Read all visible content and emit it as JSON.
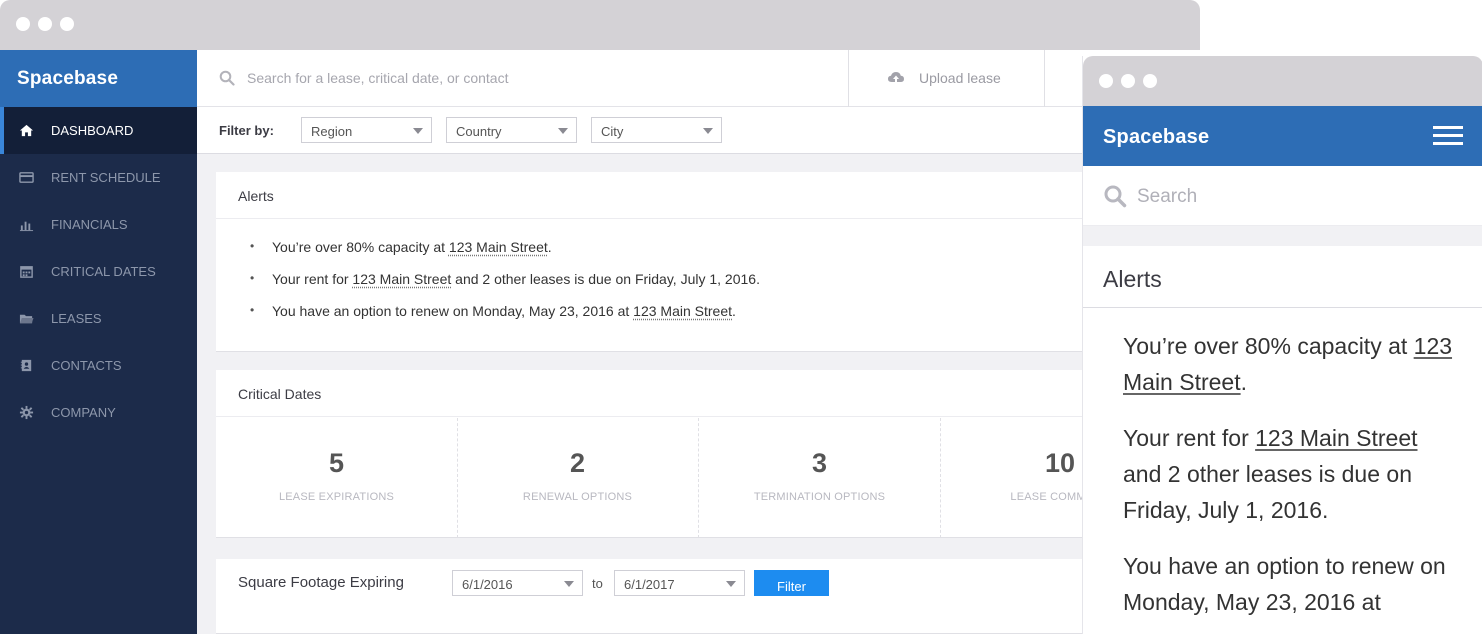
{
  "desktop": {
    "brand": "Spacebase",
    "nav": [
      {
        "label": "DASHBOARD",
        "icon": "home-icon",
        "active": true
      },
      {
        "label": "RENT SCHEDULE",
        "icon": "credit-card-icon"
      },
      {
        "label": "FINANCIALS",
        "icon": "bar-chart-icon"
      },
      {
        "label": "CRITICAL DATES",
        "icon": "calendar-icon"
      },
      {
        "label": "LEASES",
        "icon": "folder-icon"
      },
      {
        "label": "CONTACTS",
        "icon": "address-book-icon"
      },
      {
        "label": "COMPANY",
        "icon": "gear-icon"
      }
    ],
    "search": {
      "placeholder": "Search for a lease, critical date, or contact"
    },
    "upload_label": "Upload lease",
    "filter": {
      "label": "Filter by:",
      "region": "Region",
      "country": "Country",
      "city": "City"
    },
    "alerts": {
      "title": "Alerts",
      "items": [
        {
          "before": "You’re over 80% capacity at ",
          "link": "123 Main Street",
          "after": "."
        },
        {
          "before": "Your rent for ",
          "link": "123 Main Street",
          "after": " and 2 other leases is due on Friday, July 1, 2016."
        },
        {
          "before": "You have an option to renew on Monday, May 23, 2016 at ",
          "link": "123 Main Street",
          "after": "."
        }
      ]
    },
    "critical_dates": {
      "title": "Critical Dates",
      "stats": [
        {
          "value": "5",
          "label": "LEASE EXPIRATIONS"
        },
        {
          "value": "2",
          "label": "RENEWAL OPTIONS"
        },
        {
          "value": "3",
          "label": "TERMINATION OPTIONS"
        },
        {
          "value": "10",
          "label": "LEASE COMMENC"
        }
      ]
    },
    "sqft": {
      "title": "Square Footage Expiring",
      "from": "6/1/2016",
      "to_label": "to",
      "to": "6/1/2017",
      "filter_label": "Filter"
    }
  },
  "mobile": {
    "brand": "Spacebase",
    "search_placeholder": "Search",
    "alerts_title": "Alerts",
    "alerts": [
      {
        "before": "You’re over 80% capacity at ",
        "link": "123 Main Street",
        "after": "."
      },
      {
        "before": "Your rent for ",
        "link": "123 Main Street",
        "after": " and 2 other leases is due on Friday, July 1, 2016."
      },
      {
        "before": "You have an option to renew on Monday, May 23, 2016 at",
        "link": "",
        "after": ""
      }
    ]
  },
  "colors": {
    "brand_blue": "#2d6db5",
    "sidebar_navy": "#1c2b4a",
    "button_blue": "#1d8cf0"
  }
}
